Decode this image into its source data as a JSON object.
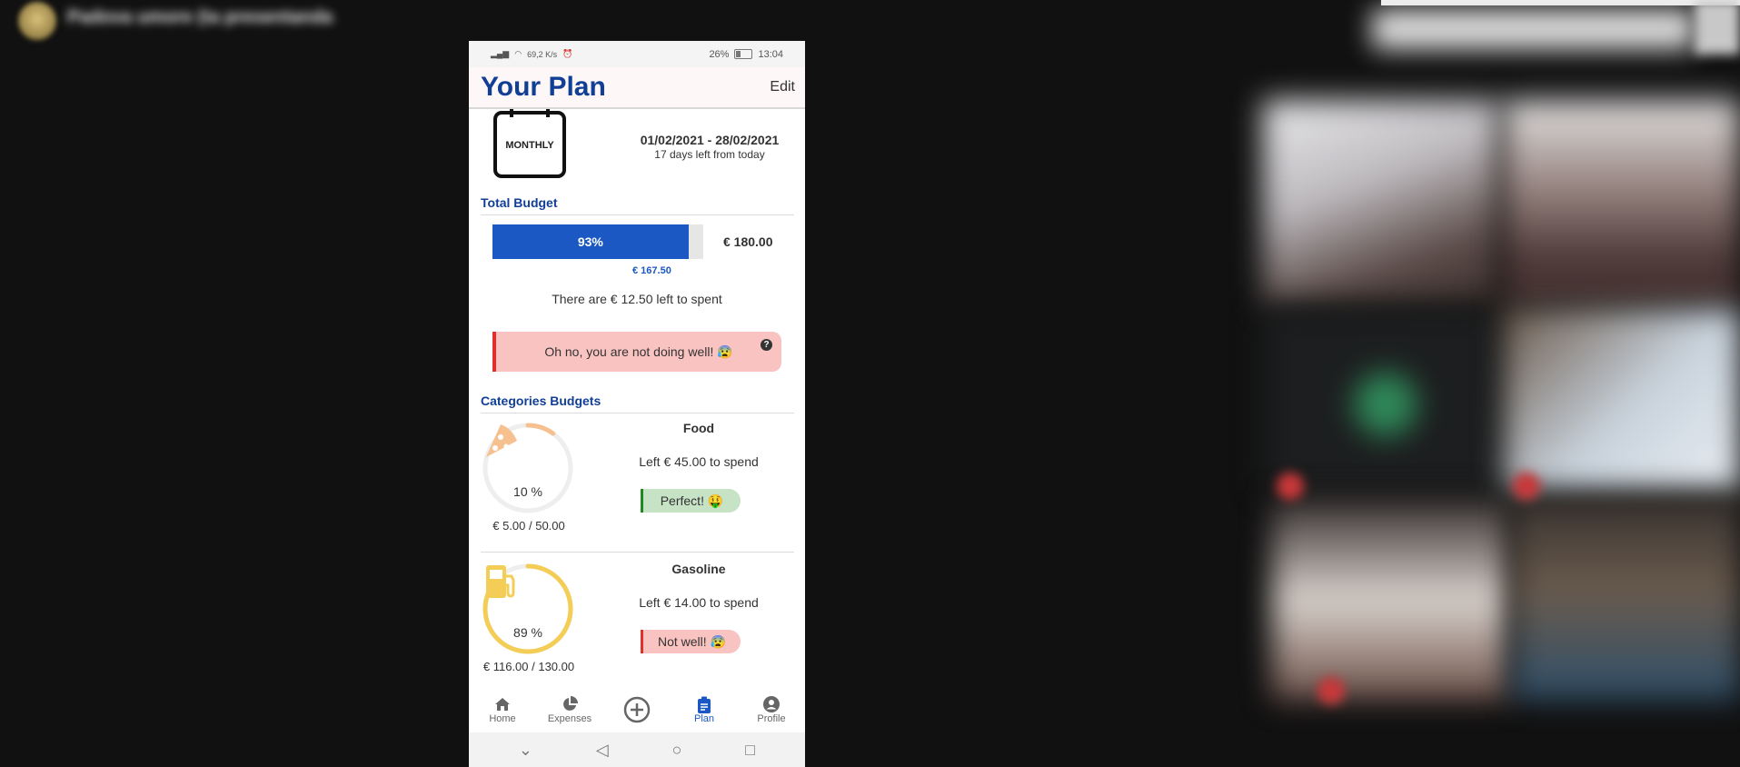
{
  "meeting": {
    "title": "Padova umore (ta presentanda",
    "accent": "#c9383a"
  },
  "status_bar": {
    "network": "69,2 K/s",
    "battery": "26%",
    "time": "13:04"
  },
  "app_bar": {
    "title": "Your Plan",
    "edit_label": "Edit"
  },
  "plan": {
    "period_badge": "MONTHLY",
    "date_range": "01/02/2021 - 28/02/2021",
    "days_left": "17 days left from today"
  },
  "total_budget": {
    "section_title": "Total Budget",
    "percent_label": "93%",
    "percent_value": 0.93,
    "total": "€ 180.00",
    "spent": "€ 167.50",
    "left_text": "There are € 12.50 left to spent",
    "alert": "Oh no, you are not doing well! 😰",
    "alert_icon": "help-icon"
  },
  "categories": {
    "section_title": "Categories Budgets",
    "items": [
      {
        "name": "Food",
        "icon": "pizza-icon",
        "color": "#f6c08f",
        "percent_label": "10 %",
        "percent_value": 0.1,
        "amount": "€ 5.00 / 50.00",
        "left_text": "Left € 45.00 to spend",
        "status": "Perfect! 🤑",
        "status_bg": "#c7e3c6",
        "status_border": "#1f8a1f"
      },
      {
        "name": "Gasoline",
        "icon": "gas-pump-icon",
        "color": "#f3cd55",
        "percent_label": "89 %",
        "percent_value": 0.89,
        "amount": "€ 116.00 / 130.00",
        "left_text": "Left € 14.00 to spend",
        "status": "Not well! 😰",
        "status_bg": "#f9c3c1",
        "status_border": "#e0302b"
      }
    ]
  },
  "bottom_nav": [
    {
      "label": "Home",
      "icon": "home-icon"
    },
    {
      "label": "Expenses",
      "icon": "pie-chart-icon"
    },
    {
      "label": "",
      "icon": "add-circle-icon"
    },
    {
      "label": "Plan",
      "icon": "clipboard-icon",
      "active": true
    },
    {
      "label": "Profile",
      "icon": "user-circle-icon"
    }
  ],
  "colors": {
    "primary": "#123f96",
    "bar_fill": "#1c58c4",
    "alert_bg": "#f9c3c1",
    "alert_border": "#e0302b"
  }
}
